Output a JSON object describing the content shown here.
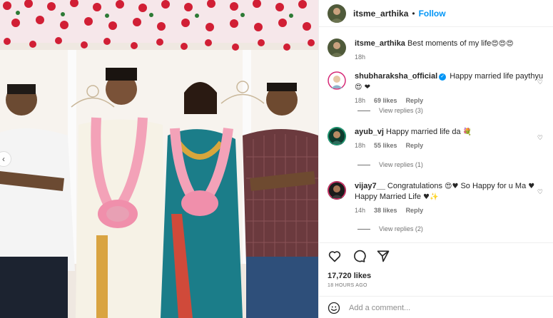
{
  "post": {
    "username": "itsme_arthika",
    "follow_label": "Follow",
    "separator": "•"
  },
  "caption": {
    "username": "itsme_arthika",
    "text": "Best moments of my life",
    "emoji": "😍😍😍",
    "time": "18h"
  },
  "comments": [
    {
      "username": "shubharaksha_official",
      "verified": true,
      "text": "Happy married life paythyu",
      "emoji": "😍 ❤",
      "time": "18h",
      "likes": "69 likes",
      "reply": "Reply",
      "view_replies": "View replies (3)"
    },
    {
      "username": "ayub_vj",
      "verified": false,
      "text": "Happy married life da",
      "emoji": "💐",
      "time": "18h",
      "likes": "55 likes",
      "reply": "Reply",
      "view_replies": "View replies (1)"
    },
    {
      "username": "vijay7__",
      "verified": false,
      "text_1": "Congratulations",
      "emoji_1": "😍♥",
      "text_2": "So Happy for u Ma",
      "emoji_2": "♥",
      "text_3": "Happy Married Life",
      "emoji_3": "♥✨",
      "time": "14h",
      "likes": "38 likes",
      "reply": "Reply",
      "view_replies": "View replies (2)"
    }
  ],
  "footer": {
    "likes": "17,720 likes",
    "time_ago": "18 HOURS AGO",
    "comment_placeholder": "Add a comment..."
  },
  "icons": {
    "heart": "heart-icon",
    "comment": "comment-icon",
    "share": "share-icon",
    "emoji": "emoji-icon",
    "prev": "chevron-left-icon"
  },
  "colors": {
    "accent": "#0095f6",
    "text": "#262626",
    "muted": "#737373"
  }
}
